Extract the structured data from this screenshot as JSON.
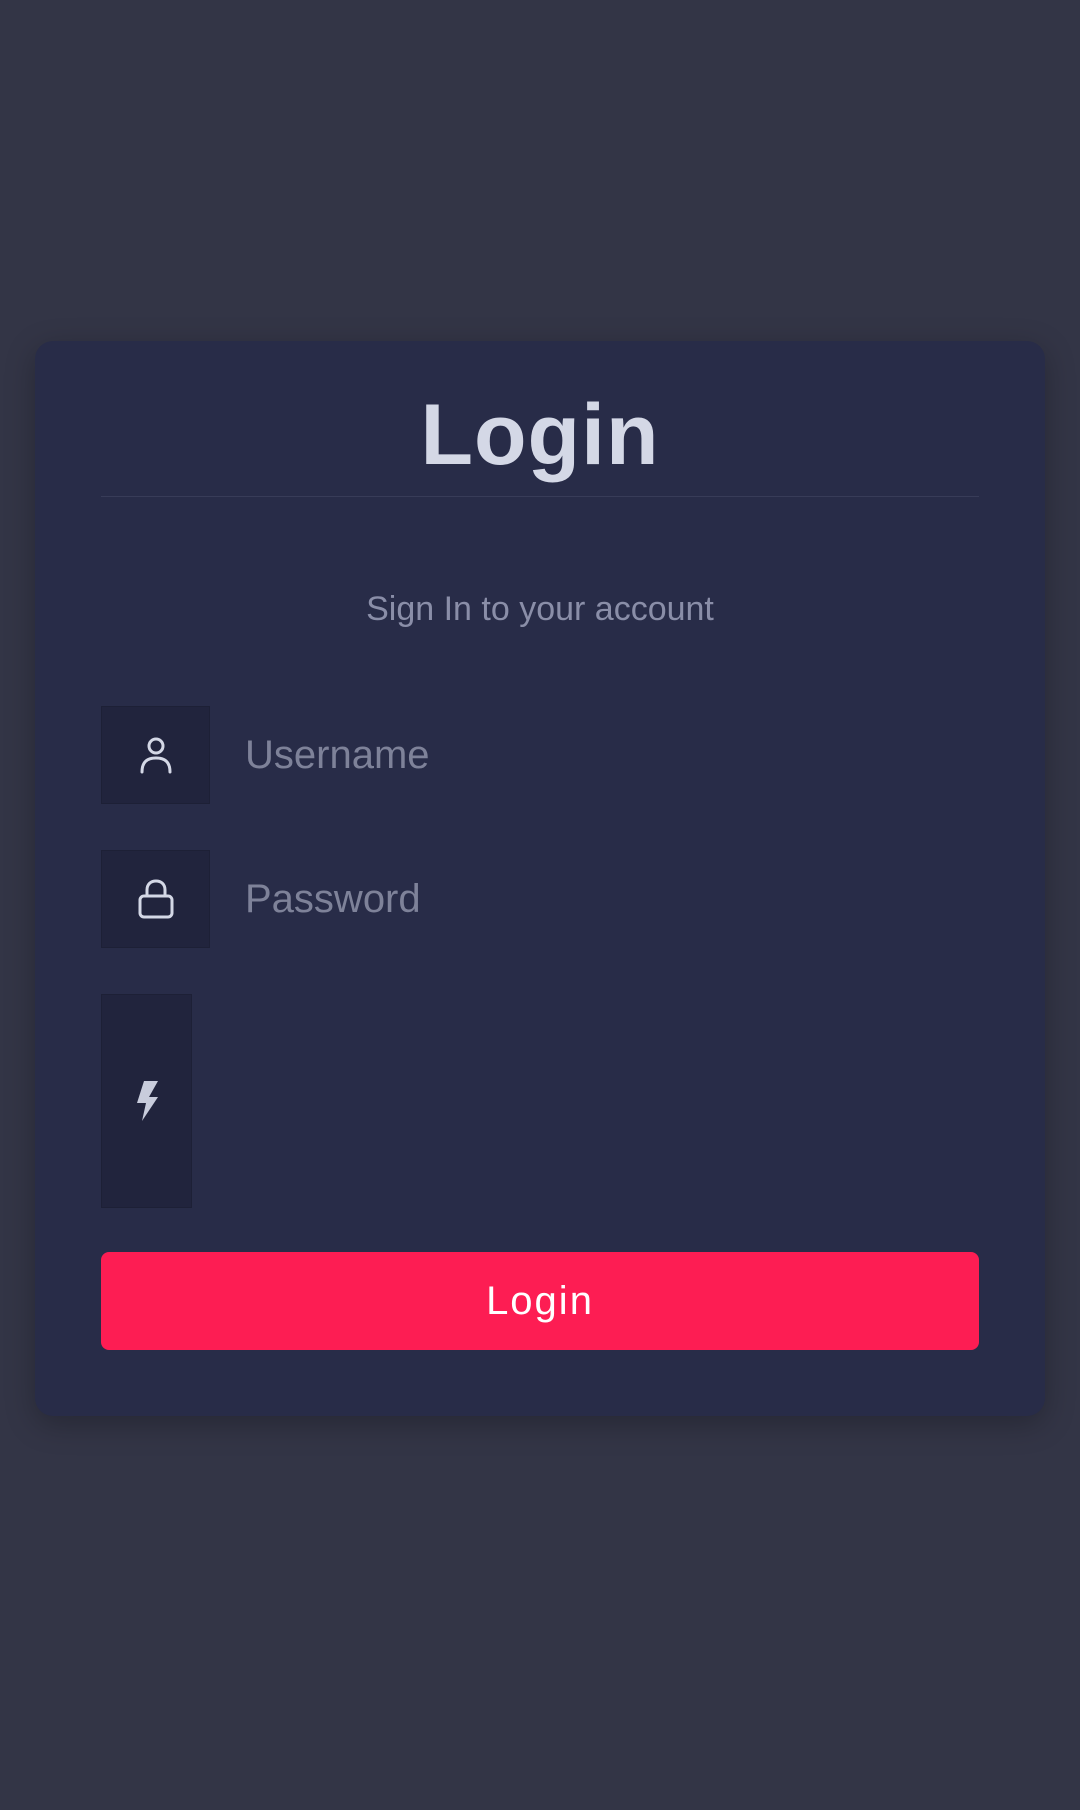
{
  "login_form": {
    "title": "Login",
    "subtitle": "Sign In to your account",
    "username": {
      "placeholder": "Username",
      "value": "",
      "icon": "user-icon"
    },
    "password": {
      "placeholder": "Password",
      "value": "",
      "icon": "lock-icon"
    },
    "captcha": {
      "icon": "bolt-icon"
    },
    "submit_label": "Login"
  },
  "colors": {
    "page_background": "#333546",
    "card_background": "#282c48",
    "icon_box_background": "#21243d",
    "title_text": "#d4d8e6",
    "muted_text": "#8a8ea8",
    "accent": "#fd1d53"
  }
}
